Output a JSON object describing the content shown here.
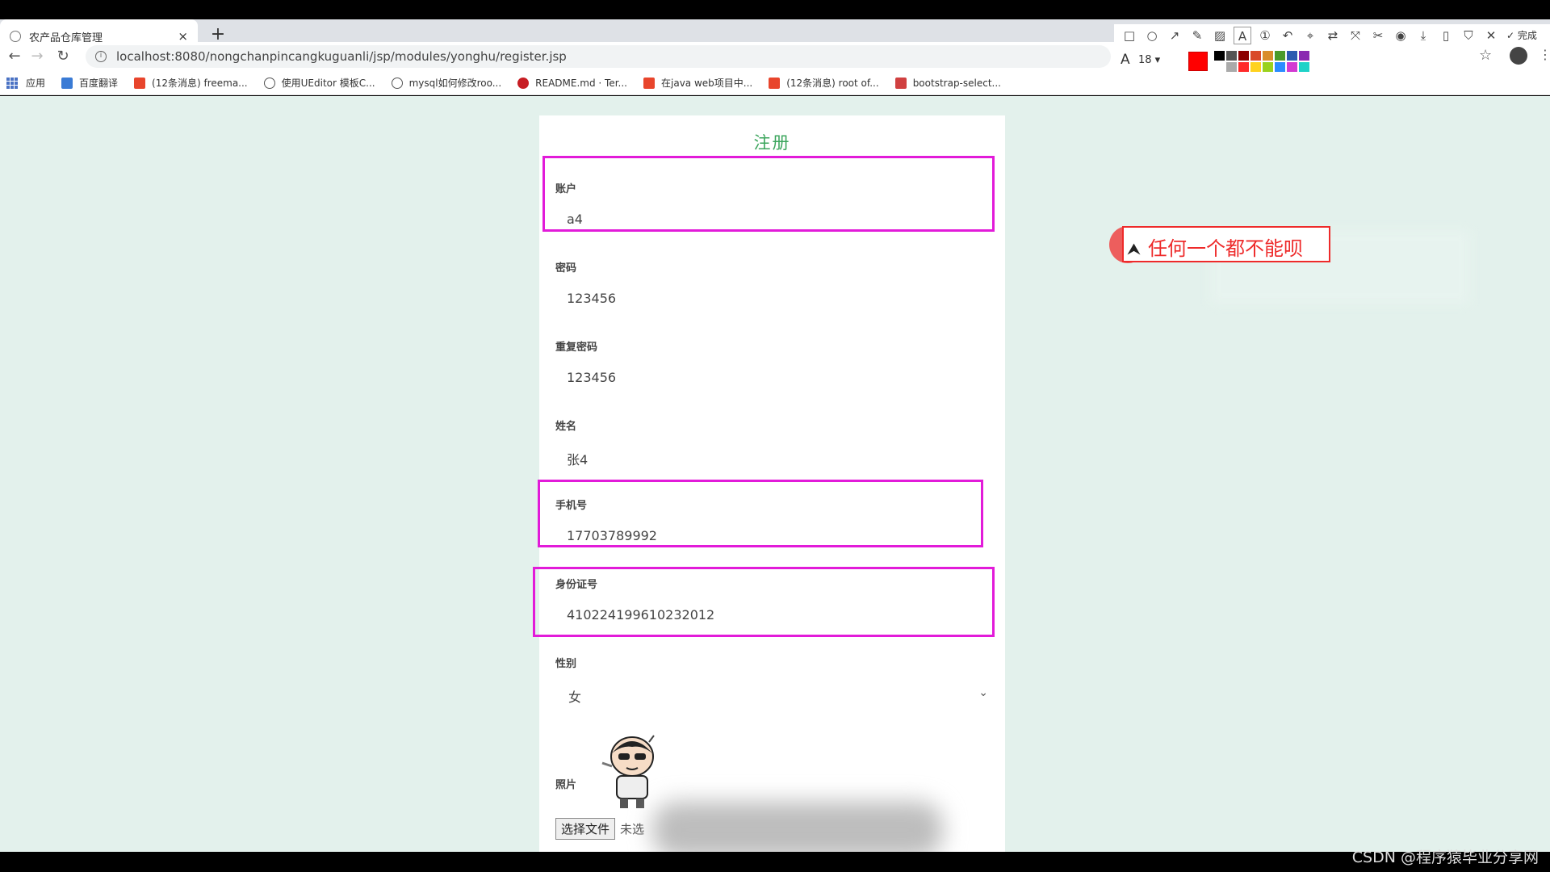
{
  "browser": {
    "tab_title": "农产品仓库管理",
    "tab_close": "×",
    "new_tab": "+",
    "url": "localhost:8080/nongchanpincangkuguanli/jsp/modules/yonghu/register.jsp",
    "bookmarks": [
      {
        "label": "应用",
        "icon": "apps-icon",
        "color": "#4a72c4"
      },
      {
        "label": "百度翻译",
        "icon": "translate-icon",
        "color": "#3a7bd5"
      },
      {
        "label": "(12条消息) freema...",
        "icon": "csdn-icon",
        "color": "#e8452c"
      },
      {
        "label": "使用UEditor 模板C...",
        "icon": "ueditor-icon",
        "color": "#555555"
      },
      {
        "label": "mysql如何修改roo...",
        "icon": "mysql-icon",
        "color": "#555555"
      },
      {
        "label": "README.md · Ter...",
        "icon": "gitee-icon",
        "color": "#c71d23"
      },
      {
        "label": "在java web项目中...",
        "icon": "csdn-icon",
        "color": "#e8452c"
      },
      {
        "label": "(12条消息) root of...",
        "icon": "csdn-icon",
        "color": "#e8452c"
      },
      {
        "label": "bootstrap-select...",
        "icon": "bookmark-icon",
        "color": "#d04040"
      }
    ]
  },
  "screenshot_tool": {
    "done_label": "完成",
    "font_size": "18",
    "current_color": "#ff0000",
    "palette": [
      "#000000",
      "#555555",
      "#8b0000",
      "#d94a2a",
      "#d98c2a",
      "#4a9a2a",
      "#2a5ab0",
      "#8a2ab0",
      "#ffffff",
      "#aaaaaa",
      "#ff2a2a",
      "#ffd21e",
      "#9ad21e",
      "#2a8cff",
      "#d23ad2",
      "#1ed2c8"
    ]
  },
  "form": {
    "title": "注册",
    "fields": [
      {
        "label": "账户",
        "value": "a4"
      },
      {
        "label": "密码",
        "value": "123456"
      },
      {
        "label": "重复密码",
        "value": "123456"
      },
      {
        "label": "姓名",
        "value": "张4"
      },
      {
        "label": "手机号",
        "value": "17703789992"
      },
      {
        "label": "身份证号",
        "value": "410224199610232012"
      }
    ],
    "gender": {
      "label": "性别",
      "value": "女"
    },
    "photo": {
      "label": "照片",
      "button": "选择文件",
      "status": "未选"
    }
  },
  "annotation": {
    "note": "任何一个都不能呗",
    "box_color": "#e21bd9",
    "note_color": "#ee2a2a"
  },
  "watermark": "CSDN @程序猿毕业分享网"
}
